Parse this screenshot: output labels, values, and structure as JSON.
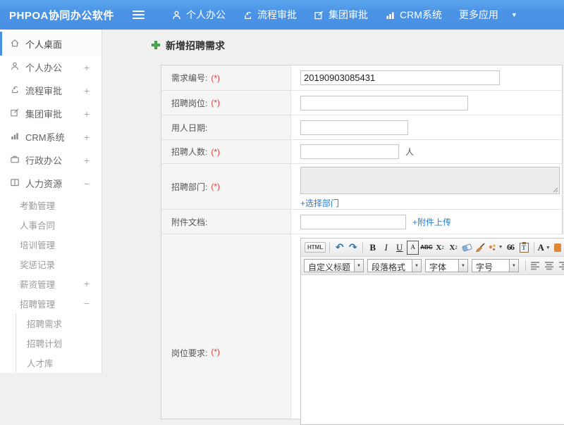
{
  "navbar": {
    "logo": "PHPOA协同办公软件",
    "items": [
      {
        "label": "个人办公",
        "icon": "user-icon"
      },
      {
        "label": "流程审批",
        "icon": "workflow-icon"
      },
      {
        "label": "集团审批",
        "icon": "edit-square-icon"
      },
      {
        "label": "CRM系统",
        "icon": "bar-chart-icon"
      },
      {
        "label": "更多应用",
        "icon": "caret-down-icon"
      }
    ]
  },
  "sidebar": {
    "items": [
      {
        "label": "个人桌面",
        "icon": "home-icon",
        "active": true
      },
      {
        "label": "个人办公",
        "icon": "user-icon",
        "expander": "+"
      },
      {
        "label": "流程审批",
        "icon": "workflow-icon",
        "expander": "+"
      },
      {
        "label": "集团审批",
        "icon": "edit-square-icon",
        "expander": "+"
      },
      {
        "label": "CRM系统",
        "icon": "bar-chart-icon",
        "expander": "+"
      },
      {
        "label": "行政办公",
        "icon": "briefcase-icon",
        "expander": "+"
      },
      {
        "label": "人力资源",
        "icon": "book-icon",
        "expander": "−"
      }
    ],
    "submenu": [
      {
        "label": "考勤管理"
      },
      {
        "label": "人事合同"
      },
      {
        "label": "培训管理"
      },
      {
        "label": "奖惩记录"
      },
      {
        "label": "薪资管理",
        "expander": "+"
      },
      {
        "label": "招聘管理",
        "expander": "−"
      }
    ],
    "subsubmenu": [
      {
        "label": "招聘需求"
      },
      {
        "label": "招聘计划"
      },
      {
        "label": "人才库"
      }
    ]
  },
  "main": {
    "title": "新增招聘需求",
    "form": {
      "rows": [
        {
          "label": "需求编号:",
          "required": "(*)",
          "value": "20190903085431"
        },
        {
          "label": "招聘岗位:",
          "required": "(*)"
        },
        {
          "label": "用人日期:"
        },
        {
          "label": "招聘人数:",
          "required": "(*)",
          "suffix": "人"
        },
        {
          "label": "招聘部门:",
          "required": "(*)",
          "link": "+选择部门"
        },
        {
          "label": "附件文档:",
          "link": "+附件上传"
        },
        {
          "label": "岗位要求:",
          "required": "(*)"
        }
      ]
    },
    "editor": {
      "html_button": "HTML",
      "bold": "B",
      "italic": "I",
      "underline": "U",
      "font_box": "A",
      "strike": "ABC",
      "sup_base": "X",
      "sup_exp": "2",
      "sub_base": "X",
      "sub_exp": "2",
      "quote": "66",
      "paste_letter": "T",
      "font_color": "A",
      "dropdowns": [
        {
          "label": "自定义标题"
        },
        {
          "label": "段落格式"
        },
        {
          "label": "字体"
        },
        {
          "label": "字号"
        }
      ]
    }
  },
  "colors": {
    "navbar_blue": "#4a90e2",
    "required_red": "#e53d3d",
    "link_blue": "#2a7ed0",
    "title_green": "#4caf50"
  }
}
